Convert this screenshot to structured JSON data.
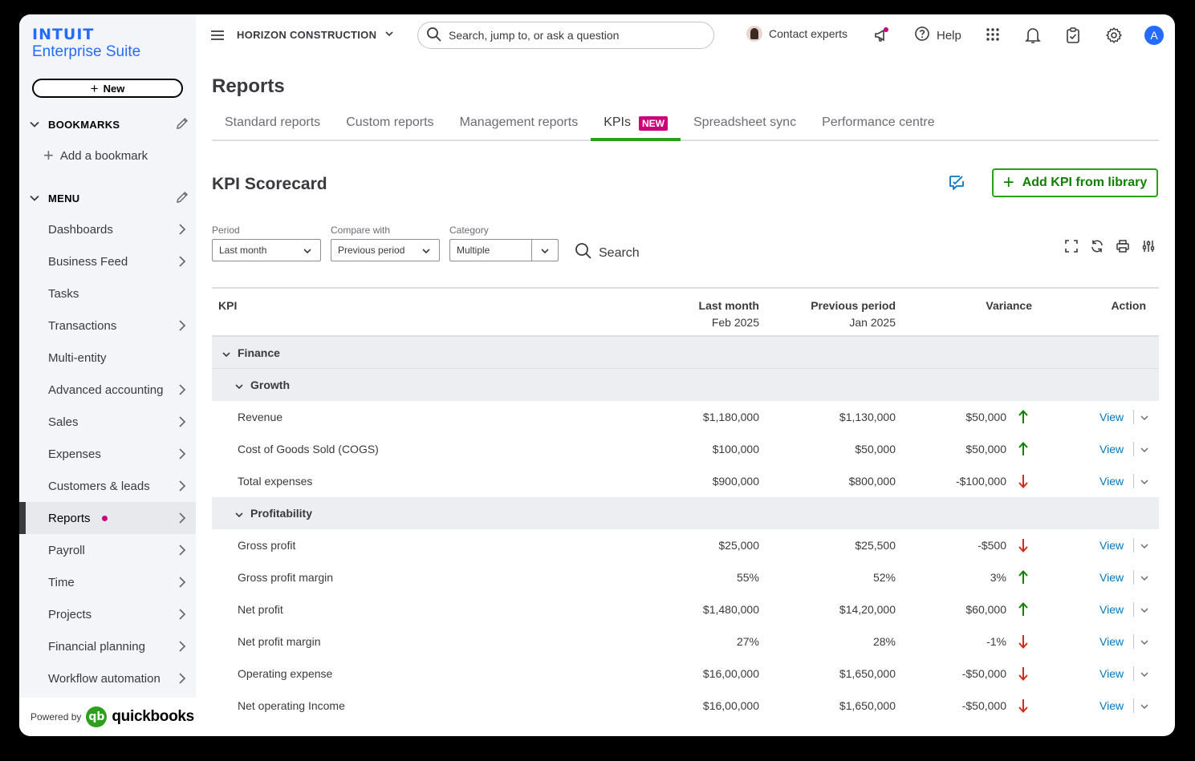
{
  "brand": {
    "line1": "INTUIT",
    "line2": "Enterprise Suite"
  },
  "sidebar": {
    "new_label": "New",
    "bookmarks_heading": "BOOKMARKS",
    "add_bookmark": "Add a bookmark",
    "menu_heading": "MENU",
    "items": [
      {
        "label": "Dashboards",
        "has_arrow": true
      },
      {
        "label": "Business Feed",
        "has_arrow": true
      },
      {
        "label": "Tasks",
        "has_arrow": false
      },
      {
        "label": "Transactions",
        "has_arrow": true
      },
      {
        "label": "Multi-entity",
        "has_arrow": false
      },
      {
        "label": "Advanced accounting",
        "has_arrow": true
      },
      {
        "label": "Sales",
        "has_arrow": true
      },
      {
        "label": "Expenses",
        "has_arrow": true
      },
      {
        "label": "Customers & leads",
        "has_arrow": true
      },
      {
        "label": "Reports",
        "has_arrow": true,
        "active": true
      },
      {
        "label": "Payroll",
        "has_arrow": true
      },
      {
        "label": "Time",
        "has_arrow": true
      },
      {
        "label": "Projects",
        "has_arrow": true
      },
      {
        "label": "Financial planning",
        "has_arrow": true
      },
      {
        "label": "Workflow automation",
        "has_arrow": true
      }
    ],
    "powered_by": "Powered by",
    "qb_mark": "qb",
    "qb_word": "quickbooks"
  },
  "topbar": {
    "company": "HORIZON CONSTRUCTION",
    "search_placeholder": "Search, jump to, or ask a question",
    "contact": "Contact experts",
    "help": "Help",
    "avatar_initial": "A"
  },
  "page": {
    "title": "Reports",
    "tabs": [
      {
        "label": "Standard reports"
      },
      {
        "label": "Custom reports"
      },
      {
        "label": "Management reports"
      },
      {
        "label": "KPIs",
        "badge": "NEW",
        "active": true
      },
      {
        "label": "Spreadsheet sync"
      },
      {
        "label": "Performance centre"
      }
    ]
  },
  "scorecard": {
    "title": "KPI Scorecard",
    "add_button": "Add KPI from library",
    "filters": {
      "period_label": "Period",
      "period_value": "Last month",
      "compare_label": "Compare with",
      "compare_value": "Previous period",
      "category_label": "Category",
      "category_value": "Multiple"
    },
    "search_label": "Search"
  },
  "table": {
    "headers": {
      "kpi": "KPI",
      "last_month": "Last month",
      "last_month_sub": "Feb 2025",
      "previous": "Previous period",
      "previous_sub": "Jan 2025",
      "variance": "Variance",
      "action": "Action"
    },
    "group": "Finance",
    "subgroups": [
      {
        "name": "Growth",
        "rows": [
          {
            "kpi": "Revenue",
            "last": "$1,180,000",
            "prev": "$1,130,000",
            "variance": "$50,000",
            "trend": "up"
          },
          {
            "kpi": "Cost of Goods Sold (COGS)",
            "last": "$100,000",
            "prev": "$50,000",
            "variance": "$50,000",
            "trend": "up"
          },
          {
            "kpi": "Total expenses",
            "last": "$900,000",
            "prev": "$800,000",
            "variance": "-$100,000",
            "trend": "down"
          }
        ]
      },
      {
        "name": "Profitability",
        "rows": [
          {
            "kpi": "Gross profit",
            "last": "$25,000",
            "prev": "$25,500",
            "variance": "-$500",
            "trend": "down"
          },
          {
            "kpi": "Gross profit margin",
            "last": "55%",
            "prev": "52%",
            "variance": "3%",
            "trend": "up"
          },
          {
            "kpi": "Net profit",
            "last": "$1,480,000",
            "prev": "$14,20,000",
            "variance": "$60,000",
            "trend": "up"
          },
          {
            "kpi": "Net profit margin",
            "last": "27%",
            "prev": "28%",
            "variance": "-1%",
            "trend": "down"
          },
          {
            "kpi": "Operating expense",
            "last": "$16,00,000",
            "prev": "$1,650,000",
            "variance": "-$50,000",
            "trend": "down"
          },
          {
            "kpi": "Net operating Income",
            "last": "$16,00,000",
            "prev": "$1,650,000",
            "variance": "-$50,000",
            "trend": "down"
          }
        ]
      }
    ],
    "view_label": "View"
  },
  "colors": {
    "up": "#108000",
    "down": "#d52b1e",
    "link": "#0077c5",
    "accent": "#2ca01c",
    "badge": "#c9007a"
  }
}
